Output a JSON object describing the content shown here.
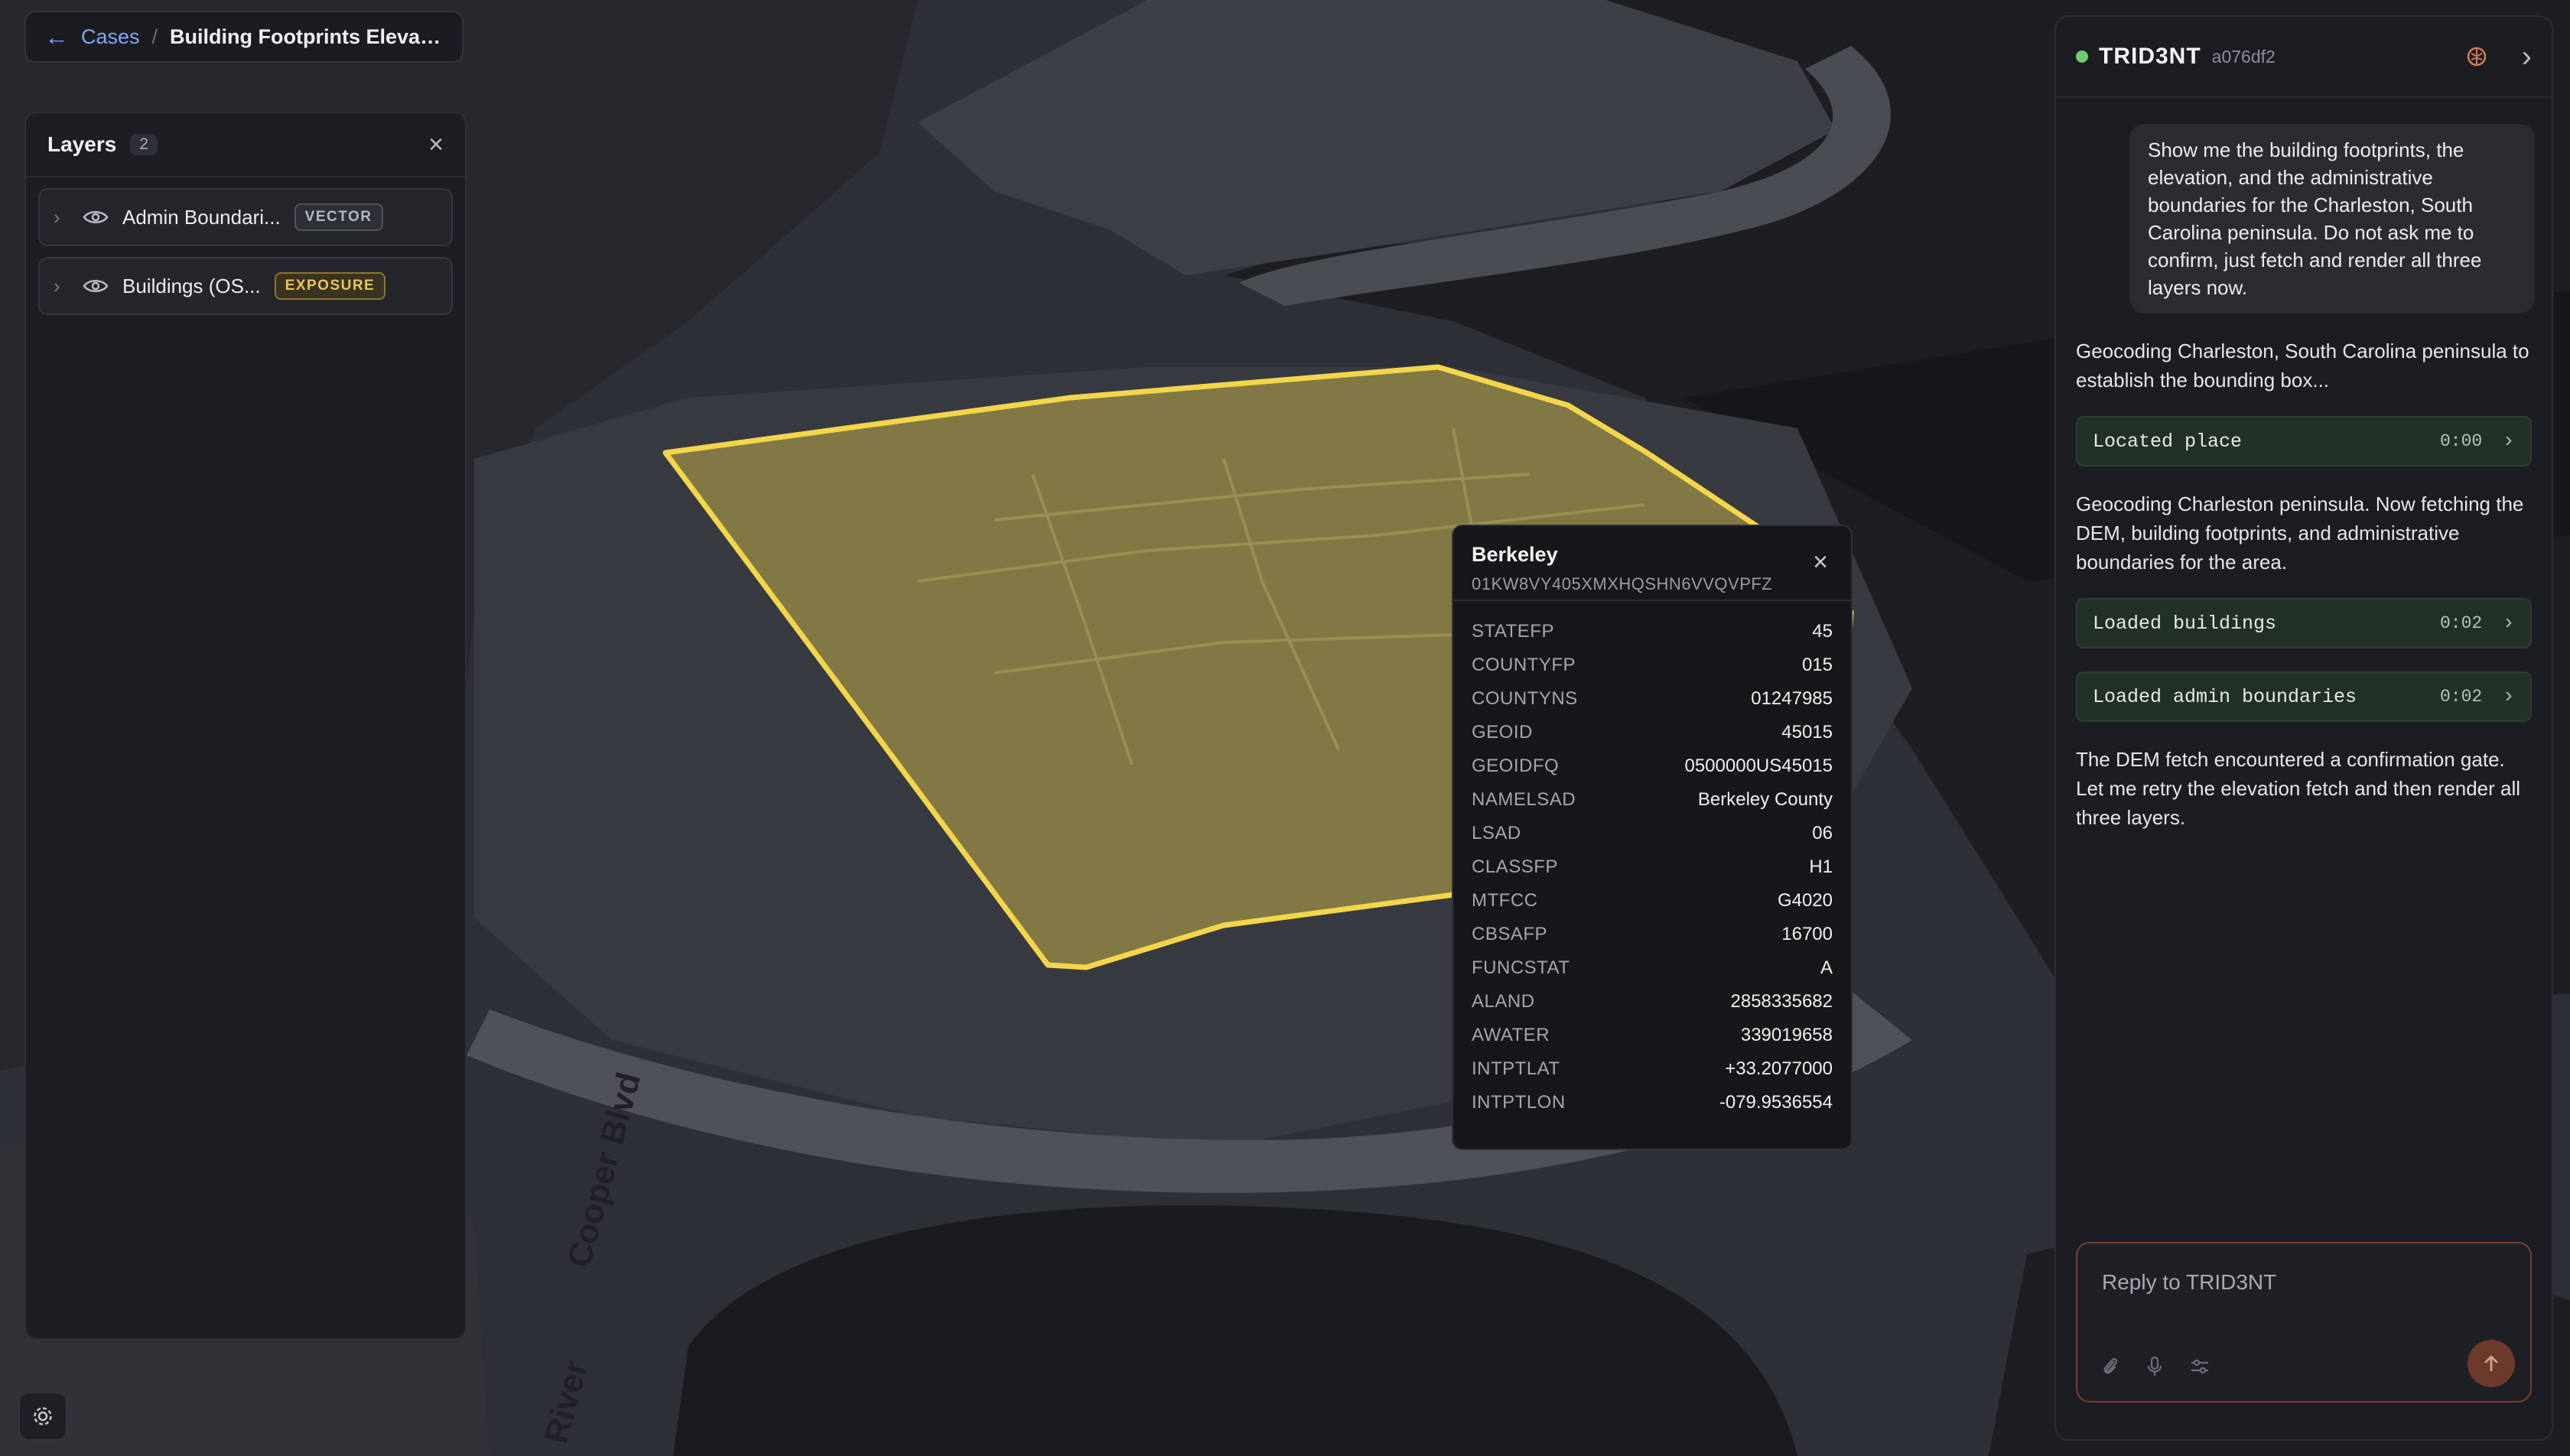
{
  "breadcrumb": {
    "root": "Cases",
    "separator": "/",
    "current": "Building Footprints Elevation ..."
  },
  "layers": {
    "title": "Layers",
    "count": "2",
    "items": [
      {
        "name": "Admin Boundari...",
        "badge": "VECTOR"
      },
      {
        "name": "Buildings (OS...",
        "badge": "EXPOSURE"
      }
    ]
  },
  "map_labels": {
    "road": "Cooper Blvd",
    "river": "River"
  },
  "popup": {
    "title": "Berkeley",
    "id": "01KW8VY405XMXHQSHN6VVQVPFZ",
    "properties": [
      {
        "key": "STATEFP",
        "value": "45"
      },
      {
        "key": "COUNTYFP",
        "value": "015"
      },
      {
        "key": "COUNTYNS",
        "value": "01247985"
      },
      {
        "key": "GEOID",
        "value": "45015"
      },
      {
        "key": "GEOIDFQ",
        "value": "0500000US45015"
      },
      {
        "key": "NAMELSAD",
        "value": "Berkeley County"
      },
      {
        "key": "LSAD",
        "value": "06"
      },
      {
        "key": "CLASSFP",
        "value": "H1"
      },
      {
        "key": "MTFCC",
        "value": "G4020"
      },
      {
        "key": "CBSAFP",
        "value": "16700"
      },
      {
        "key": "FUNCSTAT",
        "value": "A"
      },
      {
        "key": "ALAND",
        "value": "2858335682"
      },
      {
        "key": "AWATER",
        "value": "339019658"
      },
      {
        "key": "INTPTLAT",
        "value": "+33.2077000"
      },
      {
        "key": "INTPTLON",
        "value": "-079.9536554"
      }
    ]
  },
  "chat": {
    "agent_name": "TRID3NT",
    "session": "a076df2",
    "status_color": "#6ccf6a",
    "user_message": "Show me the building footprints, the elevation, and the administrative boundaries for the Charleston, South Carolina peninsula. Do not ask me to confirm, just fetch and render all three layers now.",
    "msg1": "Geocoding Charleston, South Carolina peninsula to establish the bounding box...",
    "tool1": {
      "label": "Located place",
      "time": "0:00"
    },
    "msg2": "Geocoding Charleston peninsula. Now fetching the DEM, building footprints, and administrative boundaries for the area.",
    "tool2": {
      "label": "Loaded buildings",
      "time": "0:02"
    },
    "tool3": {
      "label": "Loaded admin boundaries",
      "time": "0:02"
    },
    "msg3": "The DEM fetch encountered a confirmation gate. Let me retry the elevation fetch and then render all three layers.",
    "reply_placeholder": "Reply to TRID3NT"
  },
  "colors": {
    "accent_link": "#86a4f4",
    "boundary_fill": "#8f8445",
    "boundary_stroke": "#f3d54a",
    "send_button": "#6b3a2a"
  }
}
